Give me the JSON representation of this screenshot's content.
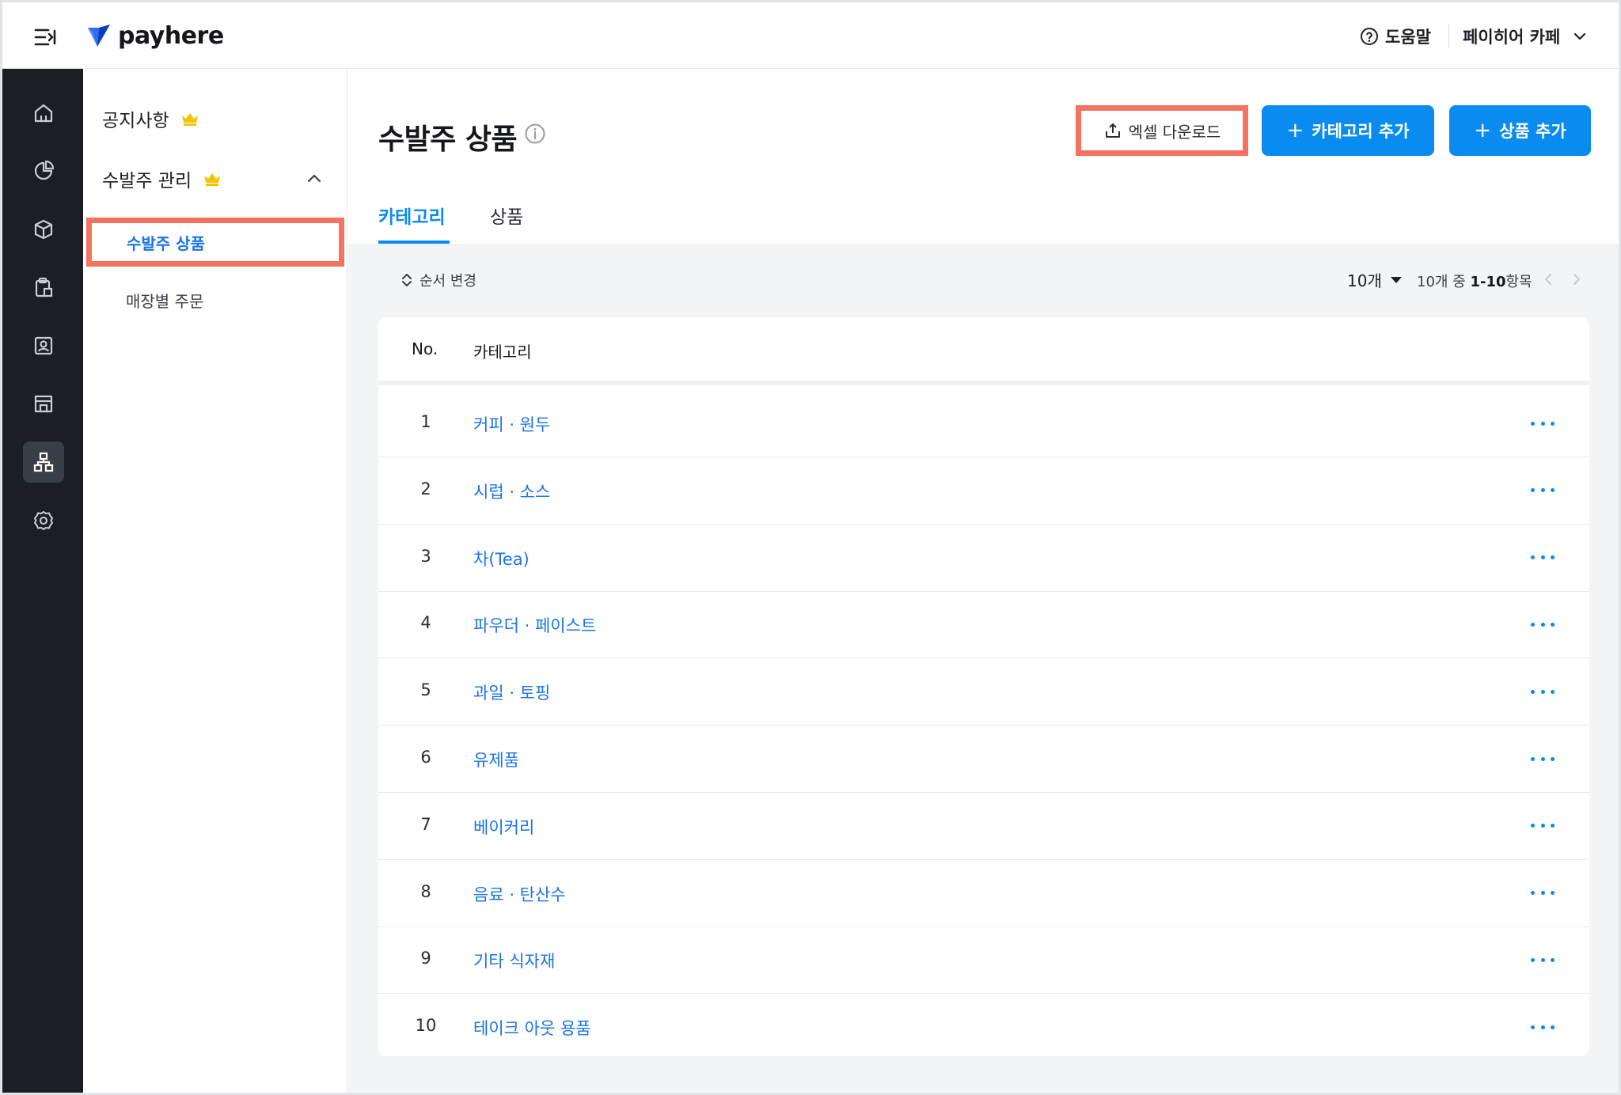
{
  "app": {
    "logo_text": "payhere"
  },
  "topbar": {
    "help_label": "도움말",
    "store_name": "페이히어 카페"
  },
  "rail": {
    "items": [
      "home-icon",
      "chart-pie-icon",
      "box-icon",
      "clipboard-icon",
      "contact-card-icon",
      "store-icon",
      "network-icon",
      "settings-icon"
    ],
    "active": "network-icon"
  },
  "subnav": {
    "notice": "공지사항",
    "order_mgmt": "수발주 관리",
    "order_products": "수발주 상품",
    "store_orders": "매장별 주문"
  },
  "page": {
    "title": "수발주 상품",
    "excel_download": "엑셀 다운로드",
    "add_category": "카테고리 추가",
    "add_product": "상품 추가",
    "tabs": [
      {
        "label": "카테고리",
        "active": true
      },
      {
        "label": "상품",
        "active": false
      }
    ]
  },
  "toolbar": {
    "reorder": "순서 변경",
    "page_size": "10개",
    "range_prefix": "10개 중 ",
    "range_bold": "1-10",
    "range_suffix": "항목"
  },
  "table": {
    "columns": [
      "No.",
      "카테고리"
    ],
    "rows": [
      {
        "no": "1",
        "category": "커피 · 원두"
      },
      {
        "no": "2",
        "category": "시럽 · 소스"
      },
      {
        "no": "3",
        "category": "차(Tea)"
      },
      {
        "no": "4",
        "category": "파우더 · 페이스트"
      },
      {
        "no": "5",
        "category": "과일 · 토핑"
      },
      {
        "no": "6",
        "category": "유제품"
      },
      {
        "no": "7",
        "category": "베이커리"
      },
      {
        "no": "8",
        "category": "음료 · 탄산수"
      },
      {
        "no": "9",
        "category": "기타 식자재"
      },
      {
        "no": "10",
        "category": "테이크 아웃 용품"
      }
    ]
  },
  "colors": {
    "accent": "#0a8bf0",
    "link": "#1a73e8",
    "highlight": "#f37260",
    "rail_bg": "#1b1e24",
    "crown": "#f5c400"
  }
}
